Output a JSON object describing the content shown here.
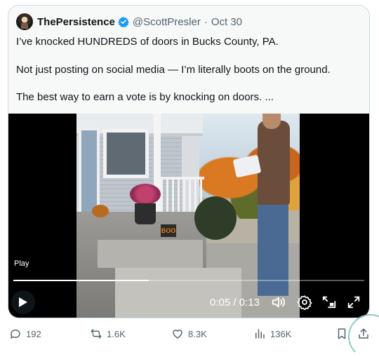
{
  "tweet": {
    "display_name": "ThePersistence",
    "handle": "@ScottPresler",
    "separator": "·",
    "date": "Oct 30",
    "lines": [
      "I’ve knocked HUNDREDS of doors in Bucks County, PA.",
      "Not just posting on social media — I’m literally boots on the ground.",
      "The best way to earn a vote is by knocking on doors. ..."
    ]
  },
  "video": {
    "play_label": "Play",
    "current_time": "0:05",
    "time_separator": "/",
    "duration": "0:13",
    "progress_fraction": 0.385,
    "boo_sign": "BOO",
    "controls": [
      "volume-icon",
      "settings-icon",
      "pip-icon",
      "fullscreen-icon"
    ]
  },
  "metrics": {
    "replies": "192",
    "reposts": "1.6K",
    "likes": "8.3K",
    "views": "136K"
  },
  "colors": {
    "verified": "#1d9bf0",
    "muted_text": "#536471",
    "card_bg": "#f7f9f9",
    "border": "#cfd9de"
  }
}
